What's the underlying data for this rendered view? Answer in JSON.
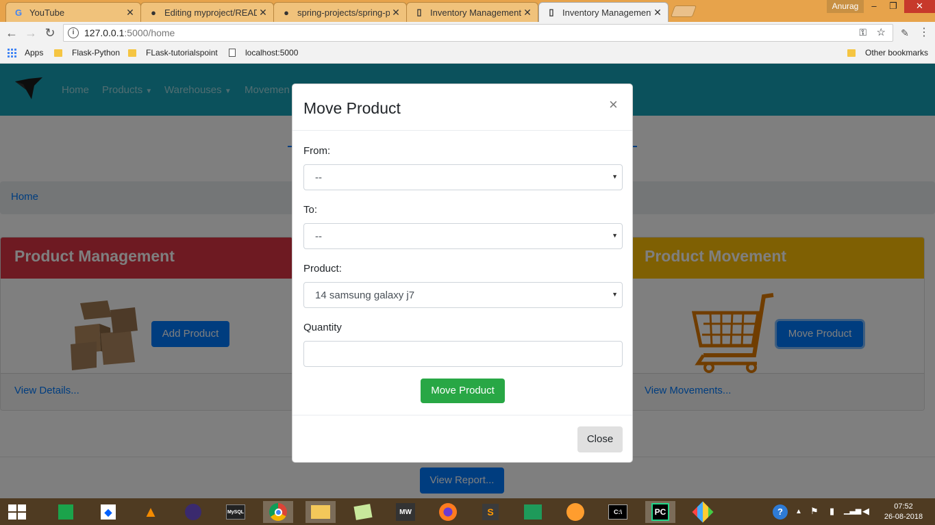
{
  "browser": {
    "tabs": [
      {
        "title": "YouTube",
        "icon": "google-icon"
      },
      {
        "title": "Editing myproject/READM",
        "icon": "github-icon"
      },
      {
        "title": "spring-projects/spring-p",
        "icon": "github-icon"
      },
      {
        "title": "Inventory Management S",
        "icon": "page-icon"
      },
      {
        "title": "Inventory Management S",
        "icon": "page-icon",
        "active": true
      }
    ],
    "user": "Anurag",
    "url_host": "127.0.0.1",
    "url_path": ":5000/home",
    "bookmarks": [
      "Apps",
      "Flask-Python",
      "FLask-tutorialspoint",
      "localhost:5000"
    ],
    "other_bookmarks": "Other bookmarks"
  },
  "navbar": {
    "links": [
      "Home",
      "Products",
      "Warehouses",
      "Movemen"
    ]
  },
  "breadcrumb": "Home",
  "cards": {
    "product_management": {
      "title": "Product Management",
      "button": "Add Product",
      "footer_link": "View Details...",
      "color": "#dc3545"
    },
    "product_movement": {
      "title": "Product Movement",
      "button": "Move Product",
      "footer_link": "View Movements...",
      "color": "#ffc107"
    }
  },
  "view_report": "View Report...",
  "modal": {
    "title": "Move Product",
    "close_x": "×",
    "from_label": "From:",
    "from_value": "--",
    "to_label": "To:",
    "to_value": "--",
    "product_label": "Product:",
    "product_value": "14 samsung galaxy j7",
    "quantity_label": "Quantity",
    "quantity_value": "",
    "submit_label": "Move Product",
    "close_label": "Close"
  },
  "taskbar": {
    "time": "07:52",
    "date": "26-08-2018"
  },
  "colors": {
    "navbar": "#17a2b8",
    "primary": "#007bff",
    "success": "#28a745"
  }
}
